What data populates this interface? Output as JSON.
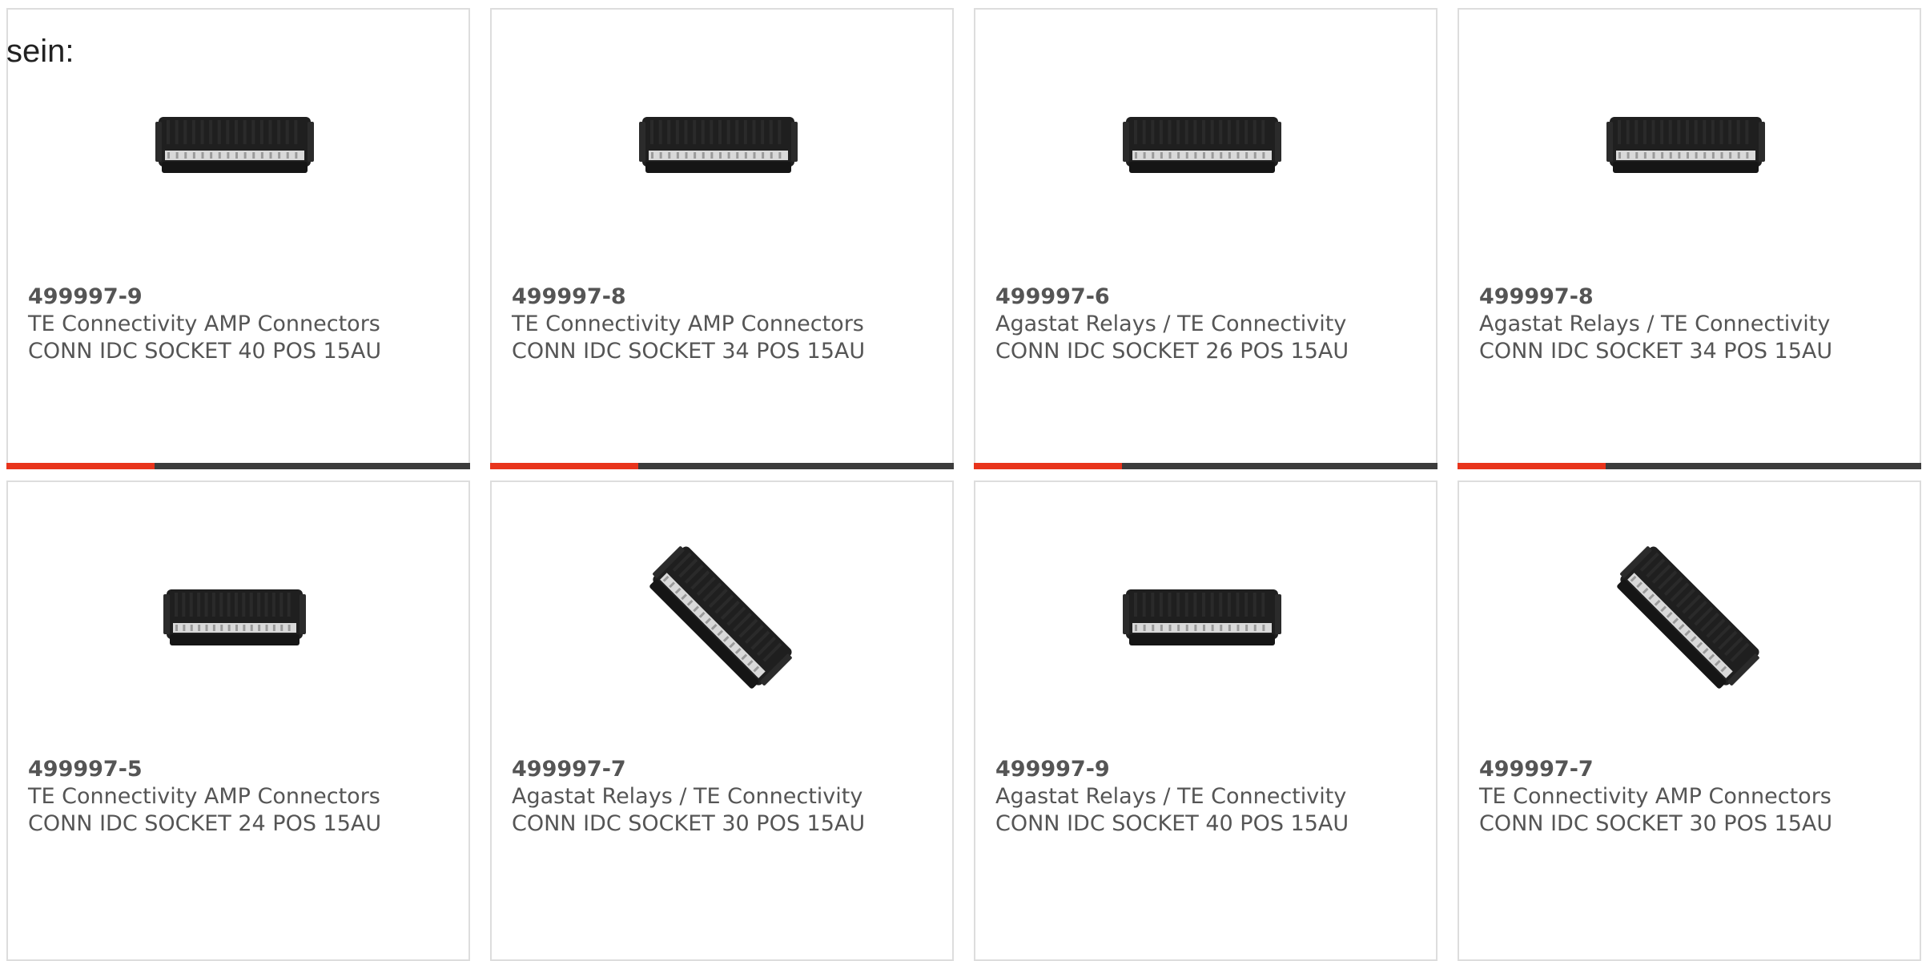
{
  "intro_text": "sein:",
  "colors": {
    "accent": "#e8341c",
    "track": "#3c3c3c",
    "border": "#dddddd",
    "text": "#555555"
  },
  "products": [
    {
      "part_number": "499997-9",
      "manufacturer": "TE Connectivity AMP Connectors",
      "description": "CONN IDC SOCKET 40 POS 15AU",
      "image": "connector-horizontal-icon",
      "progress": 0.32
    },
    {
      "part_number": "499997-8",
      "manufacturer": "TE Connectivity AMP Connectors",
      "description": "CONN IDC SOCKET 34 POS 15AU",
      "image": "connector-horizontal-icon",
      "progress": 0.32
    },
    {
      "part_number": "499997-6",
      "manufacturer": "Agastat Relays / TE Connectivity",
      "description": "CONN IDC SOCKET 26 POS 15AU",
      "image": "connector-horizontal-icon",
      "progress": 0.32
    },
    {
      "part_number": "499997-8",
      "manufacturer": "Agastat Relays / TE Connectivity",
      "description": "CONN IDC SOCKET 34 POS 15AU",
      "image": "connector-horizontal-icon",
      "progress": 0.32
    },
    {
      "part_number": "499997-5",
      "manufacturer": "TE Connectivity AMP Connectors",
      "description": "CONN IDC SOCKET 24 POS 15AU",
      "image": "connector-short-icon"
    },
    {
      "part_number": "499997-7",
      "manufacturer": "Agastat Relays / TE Connectivity",
      "description": "CONN IDC SOCKET 30 POS 15AU",
      "image": "connector-diagonal-icon"
    },
    {
      "part_number": "499997-9",
      "manufacturer": "Agastat Relays / TE Connectivity",
      "description": "CONN IDC SOCKET 40 POS 15AU",
      "image": "connector-horizontal-icon"
    },
    {
      "part_number": "499997-7",
      "manufacturer": "TE Connectivity AMP Connectors",
      "description": "CONN IDC SOCKET 30 POS 15AU",
      "image": "connector-diagonal-icon"
    }
  ]
}
